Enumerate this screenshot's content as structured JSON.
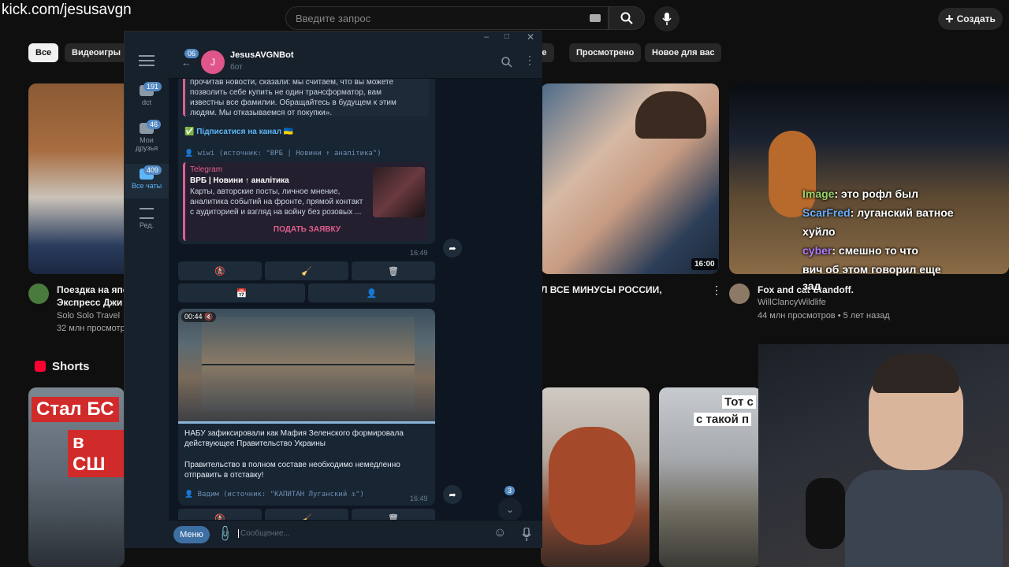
{
  "overlay": {
    "url": "kick.com/jesusavgn"
  },
  "youtube": {
    "search_placeholder": "Введите запрос",
    "create_label": "Создать",
    "chips": [
      "Все",
      "Видеоигры",
      "ые",
      "Просмотрено",
      "Новое для вас"
    ],
    "shorts_label": "Shorts",
    "videos": [
      {
        "title_line1": "Поездка на япо",
        "title_line2": "Экспресс Джи",
        "channel": "Solo Solo Travel",
        "meta": "32 млн просмотр"
      },
      {
        "title_line1": "Л ВСЕ МИНУСЫ РОССИИ,",
        "duration": "16:00"
      },
      {
        "title_line1": "Fox and cat Standoff.",
        "channel": "WillClancyWildlife",
        "meta": "44 млн просмотров • 5 лет назад"
      }
    ],
    "shorts": [
      {
        "caption_line1": "Стал БС",
        "caption_line2": "в СШ"
      },
      {
        "caption_line1": "Тот с",
        "caption_line2": "с такой п"
      }
    ]
  },
  "stream_chat": [
    {
      "user": "Image",
      "user_color": "#9ad36a",
      "text": ": это рофл был"
    },
    {
      "user": "ScarFred",
      "user_color": "#6ab0ff",
      "text": ": луганский ватное"
    },
    {
      "user": "",
      "user_color": "#ffffff",
      "text": "хуйло"
    },
    {
      "user": "cyber",
      "user_color": "#b07cff",
      "text": ": смешно то что"
    },
    {
      "user": "",
      "user_color": "#ffffff",
      "text": "вич об этом говорил еще"
    },
    {
      "user": "",
      "user_color": "#ffffff",
      "text": "зад"
    }
  ],
  "telegram": {
    "sidebar": [
      {
        "label": "dct",
        "badge": "191"
      },
      {
        "label_line1": "Мои",
        "label_line2": "друзья",
        "badge": "46"
      },
      {
        "label": "Все чаты",
        "badge": "409"
      },
      {
        "label": "Ред."
      }
    ],
    "back_badge": "06",
    "avatar_letter": "J",
    "bot_name": "JesusAVGNBot",
    "bot_status": "бот",
    "msg1": {
      "quote_line1": "прочитав новости, сказали: мы считаем, что вы можете",
      "quote_line2": "позволить себе купить не один трансформатор, вам",
      "quote_line3": "известны все фамилии. Обращайтесь в будущем к этим",
      "quote_line4": "людям. Мы отказываемся от покупки».",
      "subscribe": "✅ Підписатися на канал 🇺🇦",
      "source": "👤 wiwi (источник: \"ВРБ | Новини ↑ аналітика\")",
      "preview_site": "Telegram",
      "preview_title": "ВРБ | Новини ↑ аналітика",
      "preview_line1": "Карты, авторские посты, личное мнение,",
      "preview_line2": "аналитика событий на фронте, прямой контакт",
      "preview_line3": "с аудиторией и взгляд на войну без розовых ...",
      "preview_button": "ПОДАТЬ ЗАЯВКУ",
      "time": "16:49"
    },
    "keyboard_row1": [
      "🚷",
      "🧹",
      "🗑"
    ],
    "keyboard_row2": [
      "📅",
      "👤"
    ],
    "msg2": {
      "video_duration": "00:44",
      "text_line1": "НАБУ зафиксировали как Мафия Зеленского формировала",
      "text_line2": "действующее Правительство Украины",
      "text_line3": "Правительство в полном составе необходимо немедленно",
      "text_line4": "отправить в отставку!",
      "source": "👤 Вадим (источник: \"КАПИТАН Луганский ⚓\")",
      "time": "16:49"
    },
    "scroll_badge": "3",
    "menu_button": "Меню",
    "input_placeholder": "Сообщение..."
  }
}
